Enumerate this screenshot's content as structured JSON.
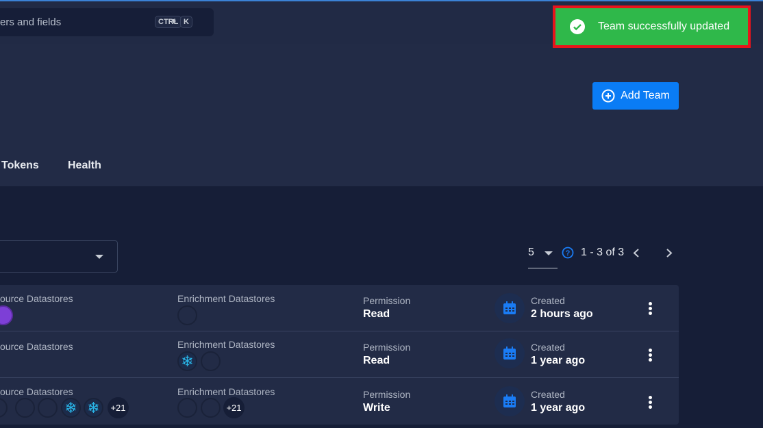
{
  "search": {
    "placeholder": "ers and fields",
    "shortcut_ctrl": "CTRL",
    "shortcut_plus": "+",
    "shortcut_key": "K"
  },
  "header": {
    "add_button": "Add Team",
    "tabs": [
      "Tokens",
      "Health"
    ]
  },
  "pagination": {
    "per_page": "5",
    "range": "1 - 3 of 3"
  },
  "labels": {
    "source": "ource Datastores",
    "enrichment": "Enrichment Datastores",
    "permission": "Permission",
    "created": "Created"
  },
  "rows": [
    {
      "permission": "Read",
      "created": "2 hours ago"
    },
    {
      "permission": "Read",
      "created": "1 year ago",
      "enrich_more": ""
    },
    {
      "permission": "Write",
      "created": "1 year ago",
      "source_more": "+21",
      "enrich_more": "+21"
    }
  ],
  "toast": {
    "message": "Team successfully updated",
    "color": "#2fb84a"
  },
  "colors": {
    "accent": "#0a7cf5",
    "highlight_border": "#e8141b"
  }
}
